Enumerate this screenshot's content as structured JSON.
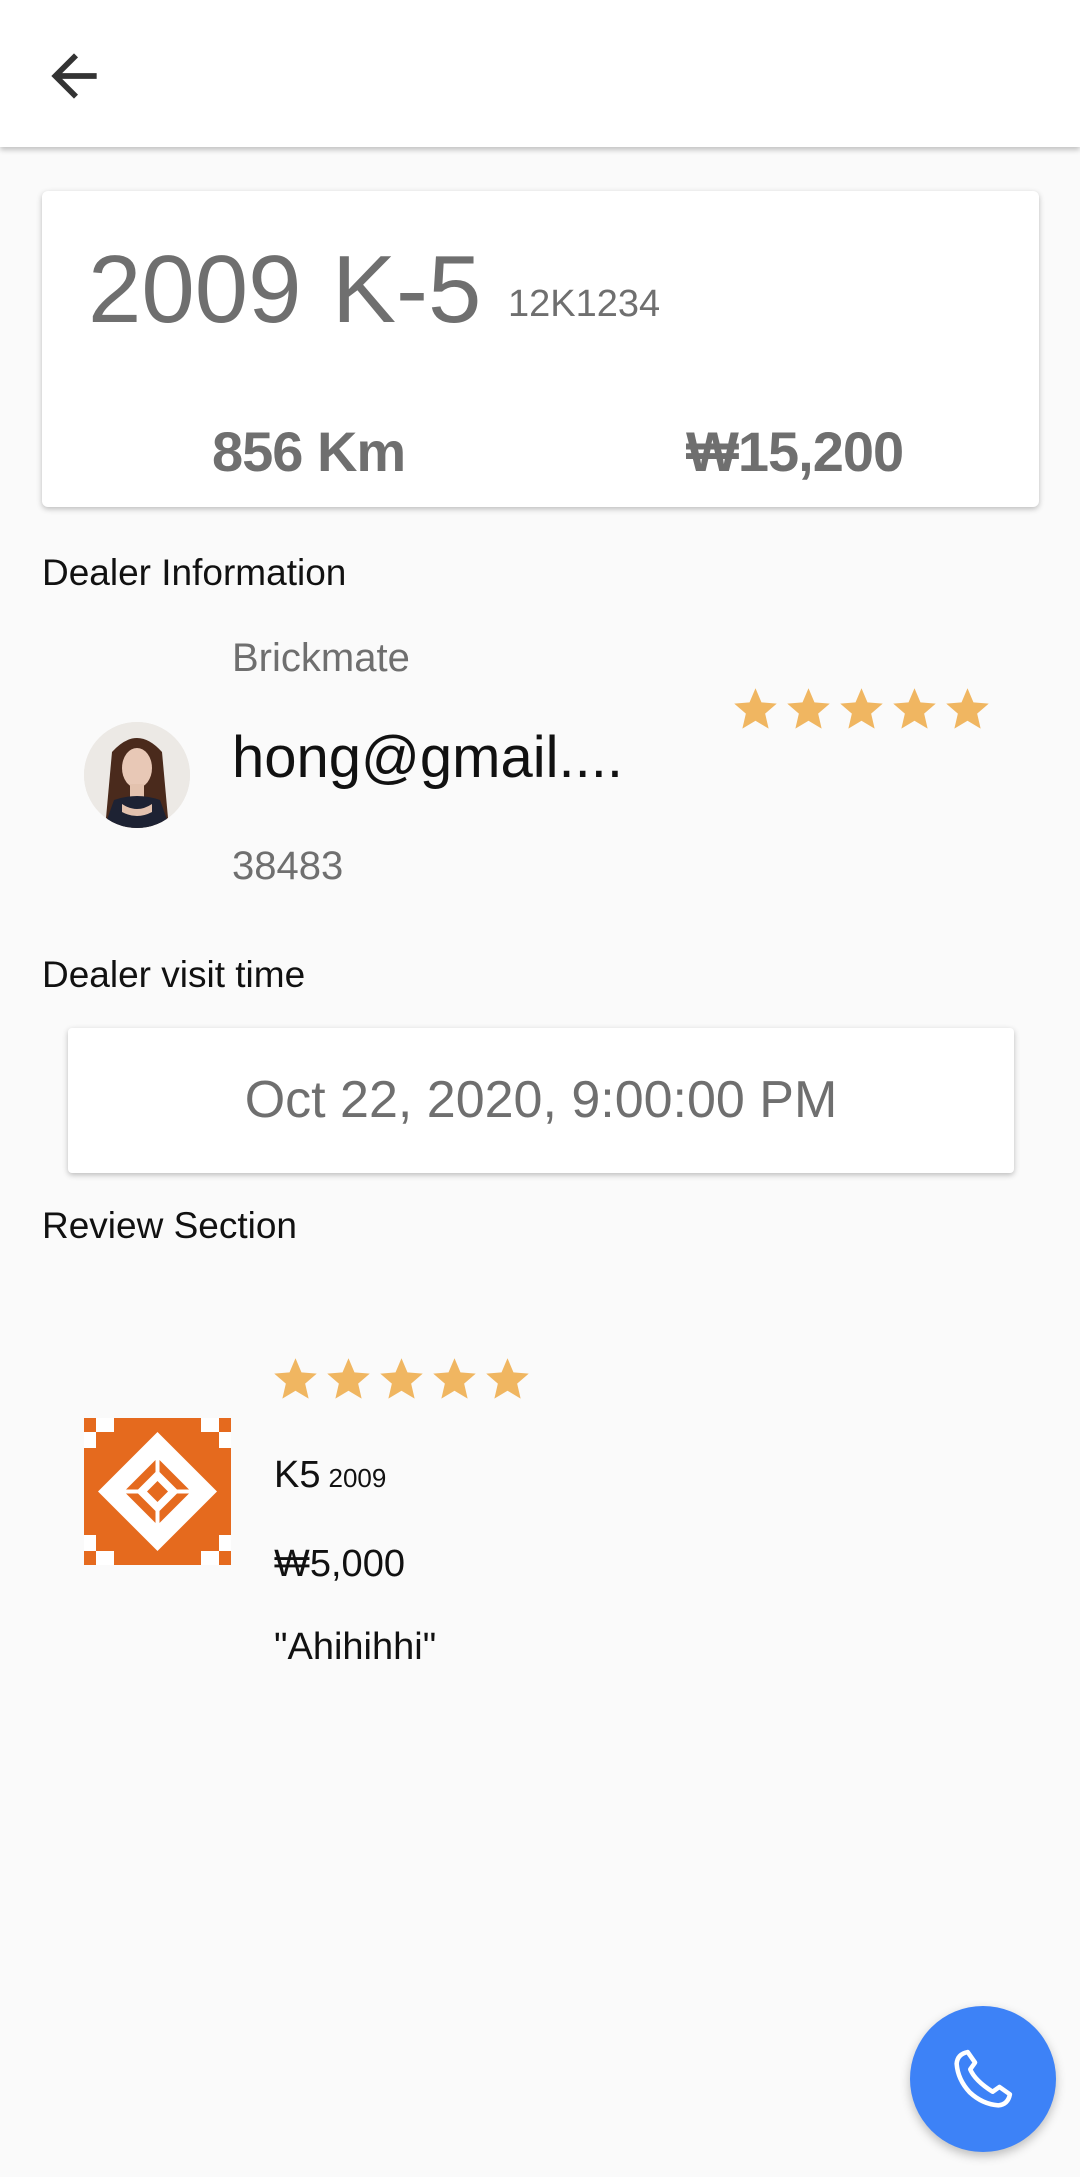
{
  "appbar": {
    "back_icon": "arrow-left-icon"
  },
  "car": {
    "year": "2009",
    "model": "K-5",
    "plate": "12K1234",
    "mileage": "856 Km",
    "price": "₩15,200"
  },
  "dealer": {
    "section_label": "Dealer Information",
    "company": "Brickmate",
    "email": "hong@gmail....",
    "code": "38483",
    "rating": 5,
    "rating_max": 5
  },
  "visit": {
    "section_label": "Dealer visit time",
    "datetime": "Oct 22, 2020, 9:00:00 PM"
  },
  "review": {
    "section_label": "Review Section",
    "rating": 5,
    "rating_max": 5,
    "model": "K5",
    "year": "2009",
    "price": "₩5,000",
    "comment": "\"Ahihihhi\""
  },
  "fab": {
    "icon": "phone-icon"
  },
  "colors": {
    "star": "#F0B661",
    "fab": "#3D82F7",
    "review_thumb": "#E56A1E",
    "secondary_text": "#6F6F6F"
  }
}
